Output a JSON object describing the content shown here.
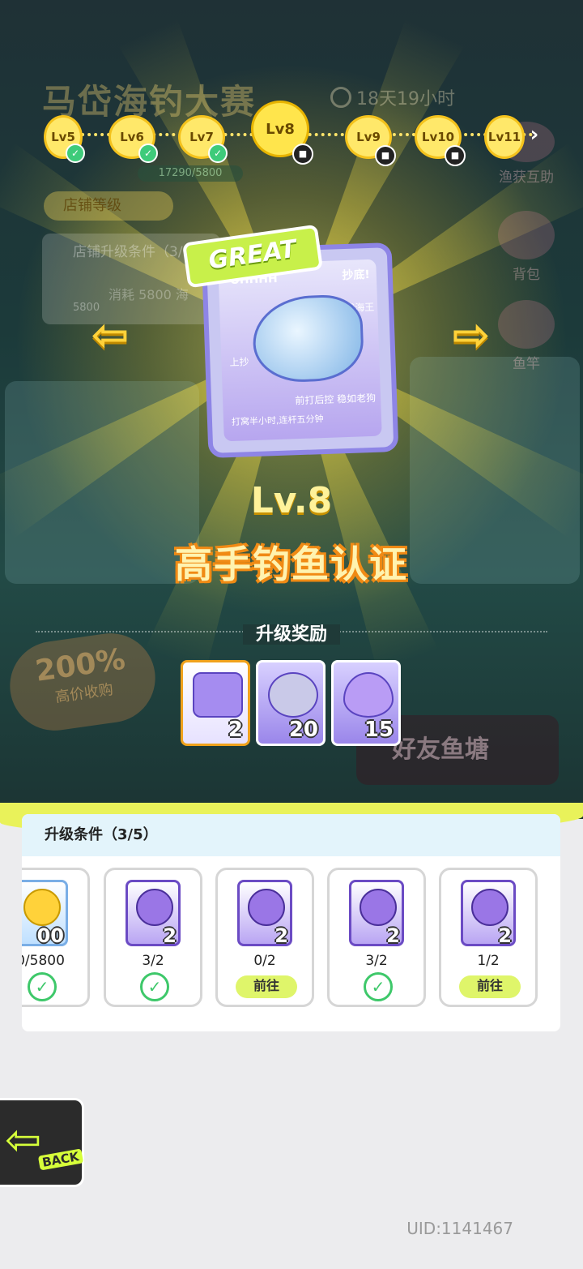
{
  "background": {
    "title": "马岱海钓大赛",
    "timer": "18天19小时",
    "shop_level_label": "店铺等级",
    "exp_value": "17290/5800",
    "upgrade_box_title": "店铺升级条件（3/5",
    "upgrade_box_cost": "消耗 5800 海",
    "upgrade_box_count": "5800",
    "side_buttons": [
      "渔获互助",
      "背包",
      "鱼竿"
    ],
    "promo_percent": "200%",
    "promo_text": "高价收购",
    "friend_pond": "好友鱼塘"
  },
  "level_track": {
    "nodes": [
      {
        "label": "Lv5",
        "state": "done"
      },
      {
        "label": "Lv6",
        "state": "done"
      },
      {
        "label": "Lv7",
        "state": "done"
      },
      {
        "label": "Lv8",
        "state": "current"
      },
      {
        "label": "Lv9",
        "state": "locked"
      },
      {
        "label": "Lv10",
        "state": "locked"
      },
      {
        "label": "Lv11",
        "state": "locked"
      }
    ],
    "left_arrow": "‹",
    "right_arrow": "›"
  },
  "card": {
    "badge": "GREAT",
    "text_top_left": "OHHHH",
    "text_top_right": "抄底!",
    "text_mid_right": "当代海王",
    "text_left": "上抄",
    "text_bottom1": "前打后控 稳如老狗",
    "text_bottom2": "打窝半小时,连杆五分钟"
  },
  "level_title": "Lv.8",
  "certification": "高手钓鱼认证",
  "rewards_label": "升级奖励",
  "rewards": [
    {
      "icon": "ticket-icon",
      "qty": "2"
    },
    {
      "icon": "can-icon",
      "qty": "20"
    },
    {
      "icon": "flame-icon",
      "qty": "15"
    }
  ],
  "conditions_header": "升级条件（3/5）",
  "conditions": [
    {
      "icon": "coin-icon",
      "count": "00",
      "progress": "0/5800",
      "status": "done"
    },
    {
      "icon": "seahorse-icon",
      "count": "2",
      "progress": "3/2",
      "status": "done"
    },
    {
      "icon": "shell-icon",
      "count": "2",
      "progress": "0/2",
      "status": "goto"
    },
    {
      "icon": "pearl-icon",
      "count": "2",
      "progress": "3/2",
      "status": "done"
    },
    {
      "icon": "coral-icon",
      "count": "2",
      "progress": "1/2",
      "status": "goto"
    }
  ],
  "goto_label": "前往",
  "back_label": "BACK",
  "uid": "UID:1141467"
}
